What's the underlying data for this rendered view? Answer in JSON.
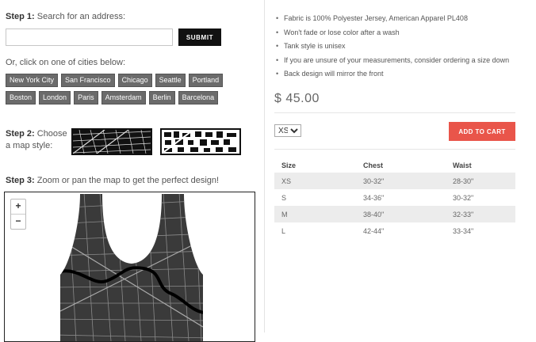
{
  "step1": {
    "title": "Step 1:",
    "text": "Search for an address:",
    "search_value": "",
    "search_placeholder": "",
    "submit_label": "SUBMIT"
  },
  "cities_label": "Or, click on one of cities below:",
  "cities": [
    [
      "New York City",
      "San Francisco",
      "Chicago",
      "Seattle",
      "Portland"
    ],
    [
      "Boston",
      "London",
      "Paris",
      "Amsterdam",
      "Berlin",
      "Barcelona"
    ]
  ],
  "step2": {
    "title": "Step 2:",
    "text_line1": "Choose",
    "text_line2": "a map style:"
  },
  "step3": {
    "title": "Step 3:",
    "text": "Zoom or pan the map to get the perfect design!"
  },
  "zoom": {
    "in": "+",
    "out": "−"
  },
  "features": [
    "Fabric is 100% Polyester Jersey, American Apparel PL408",
    "Won't fade or lose color after a wash",
    "Tank style is unisex",
    "If you are unsure of your measurements, consider ordering a size down",
    "Back design will mirror the front"
  ],
  "price": "$ 45.00",
  "size_select": {
    "selected": "XS",
    "options": [
      "XS"
    ]
  },
  "add_to_cart": "ADD TO CART",
  "size_table": {
    "headers": [
      "Size",
      "Chest",
      "Waist"
    ],
    "rows": [
      [
        "XS",
        "30-32\"",
        "28-30\""
      ],
      [
        "S",
        "34-36\"",
        "30-32\""
      ],
      [
        "M",
        "38-40\"",
        "32-33\""
      ],
      [
        "L",
        "42-44\"",
        "33-34\""
      ]
    ]
  },
  "colors": {
    "accent": "#e9554a",
    "city_tag": "#6b6b6b",
    "button_dark": "#111111"
  }
}
